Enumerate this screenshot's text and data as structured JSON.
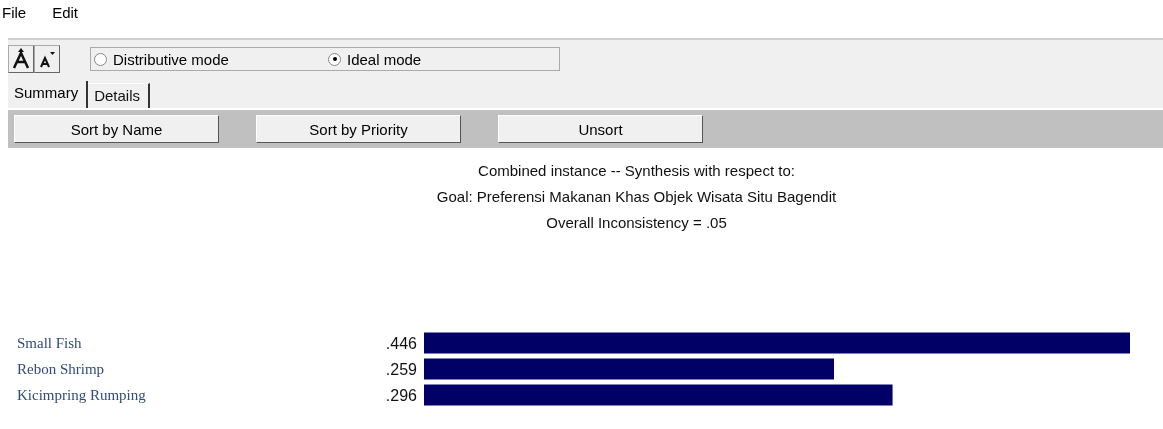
{
  "menu": [
    "File",
    "Edit"
  ],
  "modes": [
    {
      "label": "Distributive mode",
      "selected": false
    },
    {
      "label": "Ideal mode",
      "selected": true
    }
  ],
  "tabs": [
    {
      "label": "Summary",
      "selected": true
    },
    {
      "label": "Details",
      "selected": false
    }
  ],
  "sort_buttons": [
    "Sort by Name",
    "Sort by Priority",
    "Unsort"
  ],
  "header": [
    "Combined instance -- Synthesis with respect to:",
    "Goal: Preferensi Makanan Khas Objek Wisata Situ Bagendit",
    "Overall Inconsistency = .05"
  ],
  "priorities": {
    "chart_data": {
      "type": "bar",
      "orientation": "horizontal",
      "categories": [
        "Small Fish",
        "Rebon Shrimp",
        "Kicimpring Rumping"
      ],
      "values": [
        0.446,
        0.259,
        0.296
      ],
      "value_labels": [
        ".446",
        ".259",
        ".296"
      ]
    }
  }
}
